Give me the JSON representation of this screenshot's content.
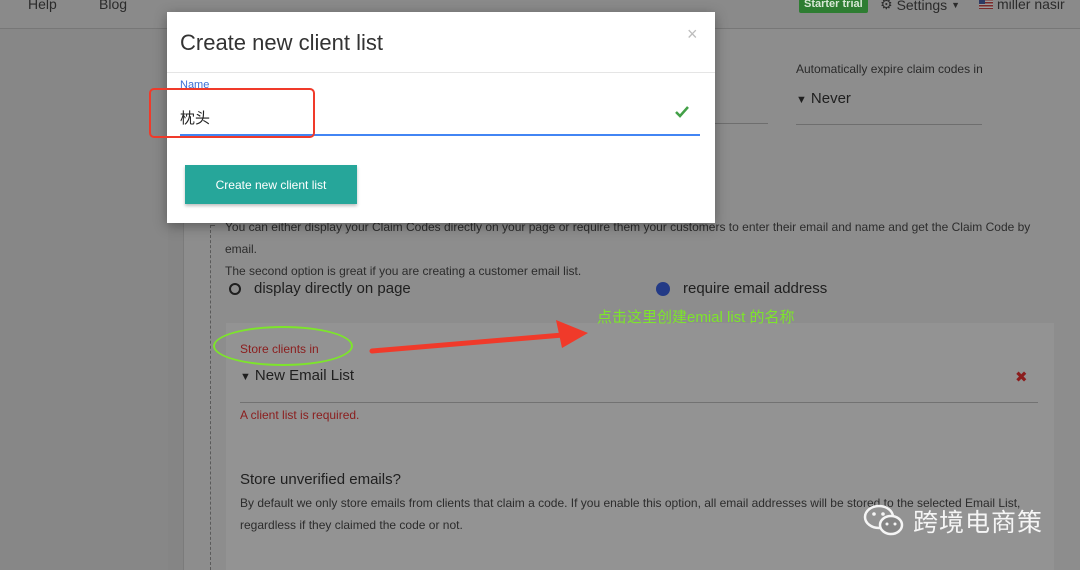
{
  "topnav": {
    "help": "Help",
    "blog": "Blog",
    "trial_badge": "Starter trial",
    "settings": "Settings",
    "user": "miller nasir"
  },
  "page": {
    "expire_label": "Automatically expire claim codes in",
    "expire_value": "Never",
    "description_line1": "You can either display your Claim Codes directly on your page or require them your customers to enter their email and name and get the Claim Code by email.",
    "description_line2": "The second option is great if you are creating a customer email list.",
    "radio_display": "display directly on page",
    "radio_email": "require email address",
    "radio_selected": "require email address",
    "store_label": "Store clients in",
    "list_value": "New Email List",
    "error_text": "A client list is required.",
    "unverified_title": "Store unverified emails?",
    "unverified_line1": "By default we only store emails from clients that claim a code. If you enable this option, all email addresses will be stored to the selected Email List,",
    "unverified_line2": "regardless if they claimed the code or not."
  },
  "modal": {
    "title": "Create new client list",
    "close": "×",
    "field_label": "Name",
    "field_value": "枕头",
    "button": "Create new client list"
  },
  "annotations": {
    "note": "点击这里创建emial list 的名称",
    "watermark": "跨境电商策"
  },
  "colors": {
    "accent": "#26a69a",
    "input_focus": "#4285f4",
    "error": "#8b1d1d",
    "annotation_green": "#7de52b",
    "annotation_red": "#f03a2a"
  }
}
